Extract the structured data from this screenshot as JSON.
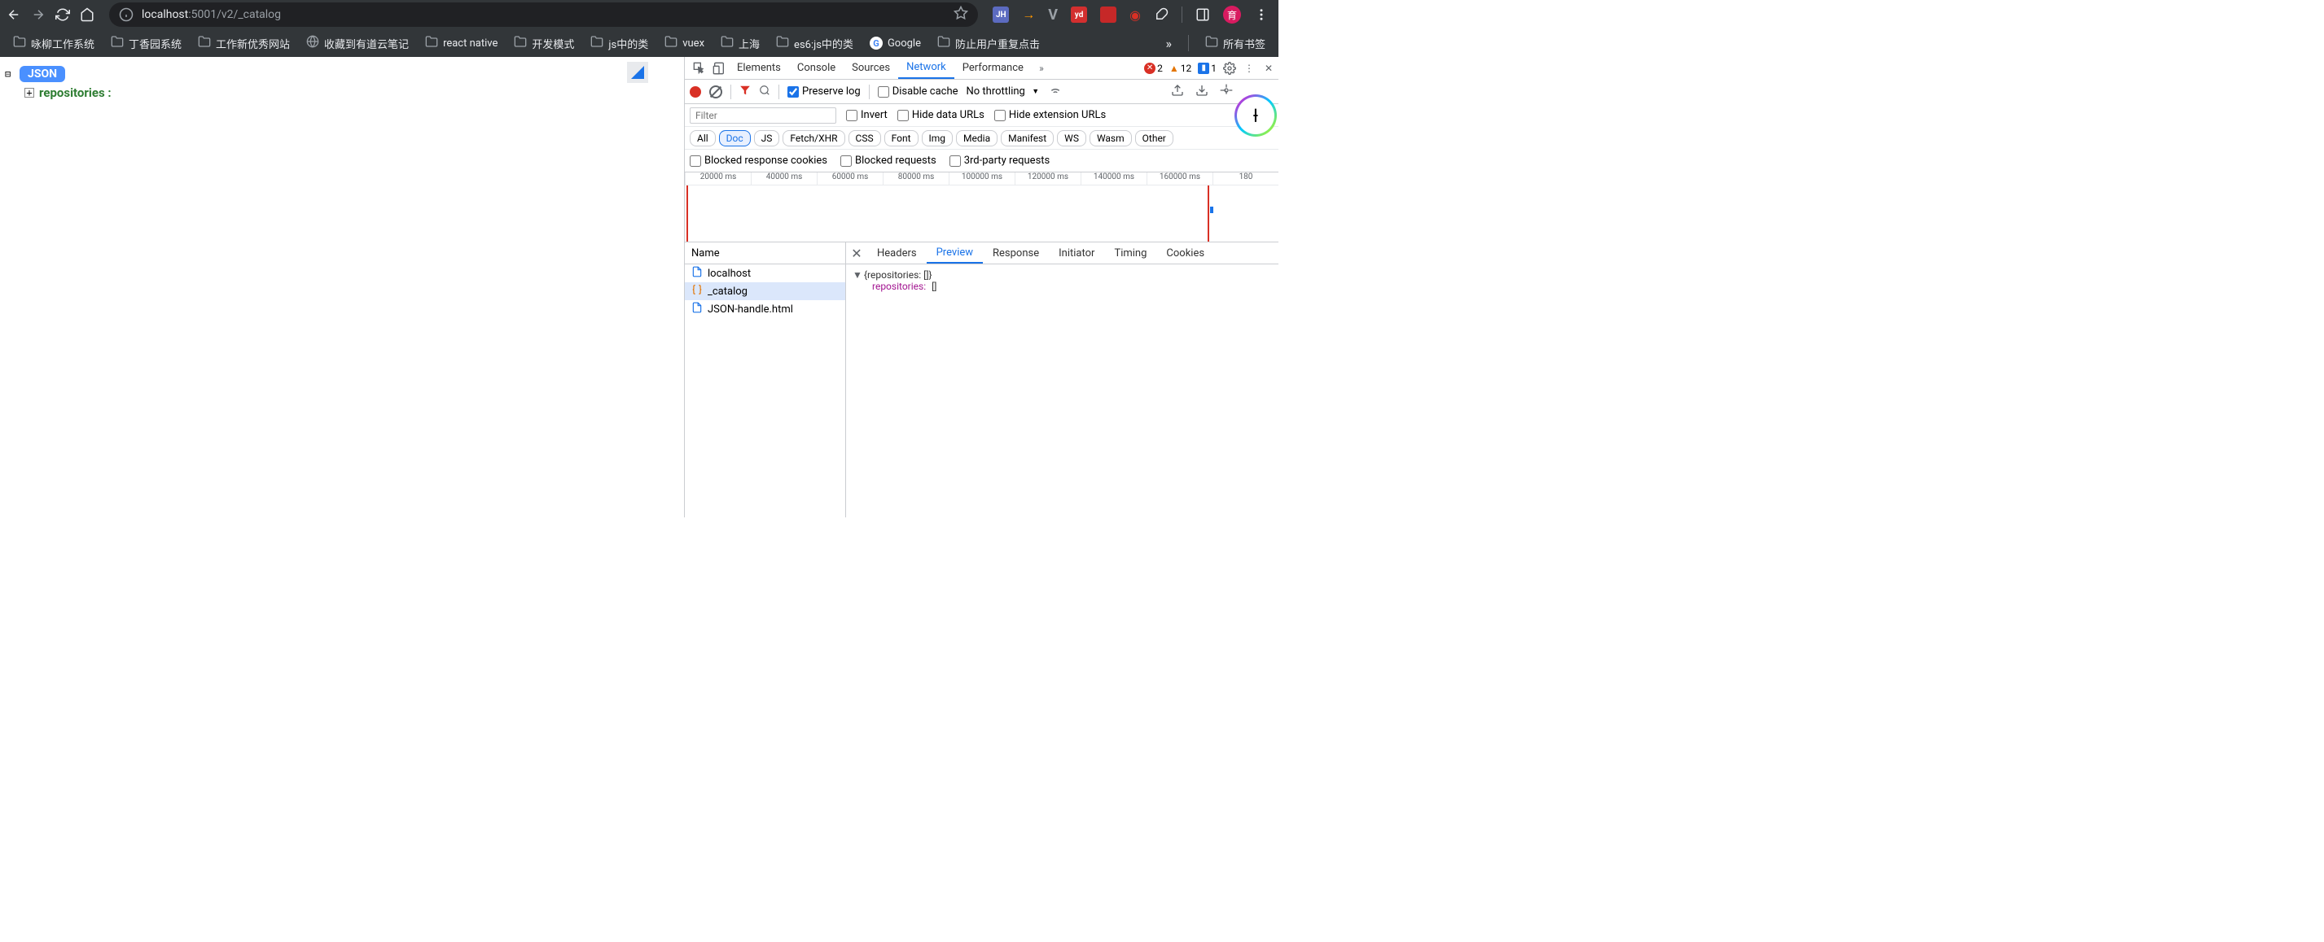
{
  "browser": {
    "url_prefix": "localhost",
    "url_port": ":5001",
    "url_path": "/v2/_catalog",
    "extensions": {
      "jh": "JH",
      "yd": "yd"
    },
    "avatar": "育"
  },
  "bookmarks": [
    {
      "icon": "folder",
      "label": "咏柳工作系统"
    },
    {
      "icon": "folder",
      "label": "丁香园系统"
    },
    {
      "icon": "folder",
      "label": "工作新优秀网站"
    },
    {
      "icon": "globe",
      "label": "收藏到有道云笔记"
    },
    {
      "icon": "folder",
      "label": "react native"
    },
    {
      "icon": "folder",
      "label": "开发模式"
    },
    {
      "icon": "folder",
      "label": "js中的类"
    },
    {
      "icon": "folder",
      "label": "vuex"
    },
    {
      "icon": "folder",
      "label": "上海"
    },
    {
      "icon": "folder",
      "label": "es6:js中的类"
    },
    {
      "icon": "google",
      "label": "Google"
    },
    {
      "icon": "folder",
      "label": "防止用户重复点击"
    }
  ],
  "all_bookmarks_label": "所有书签",
  "json_viewer": {
    "badge": "JSON",
    "key": "repositories :"
  },
  "devtools": {
    "tabs": [
      "Elements",
      "Console",
      "Sources",
      "Network",
      "Performance"
    ],
    "active_tab": "Network",
    "error_count": "2",
    "warning_count": "12",
    "info_count": "1",
    "preserve_log": "Preserve log",
    "disable_cache": "Disable cache",
    "throttling": "No throttling",
    "filter_placeholder": "Filter",
    "invert": "Invert",
    "hide_data_urls": "Hide data URLs",
    "hide_ext_urls": "Hide extension URLs",
    "types": [
      "All",
      "Doc",
      "JS",
      "Fetch/XHR",
      "CSS",
      "Font",
      "Img",
      "Media",
      "Manifest",
      "WS",
      "Wasm",
      "Other"
    ],
    "active_type": "Doc",
    "blocked_cookies": "Blocked response cookies",
    "blocked_requests": "Blocked requests",
    "third_party": "3rd-party requests",
    "timeline_ticks": [
      "20000 ms",
      "40000 ms",
      "60000 ms",
      "80000 ms",
      "100000 ms",
      "120000 ms",
      "140000 ms",
      "160000 ms",
      "180"
    ],
    "name_header": "Name",
    "requests": [
      {
        "icon": "doc",
        "name": "localhost"
      },
      {
        "icon": "json",
        "name": "_catalog"
      },
      {
        "icon": "doc",
        "name": "JSON-handle.html"
      }
    ],
    "selected_request": 1,
    "detail_tabs": [
      "Headers",
      "Preview",
      "Response",
      "Initiator",
      "Timing",
      "Cookies"
    ],
    "active_detail_tab": "Preview",
    "preview": {
      "summary": "{repositories: []}",
      "key": "repositories",
      "val": "[]"
    }
  }
}
